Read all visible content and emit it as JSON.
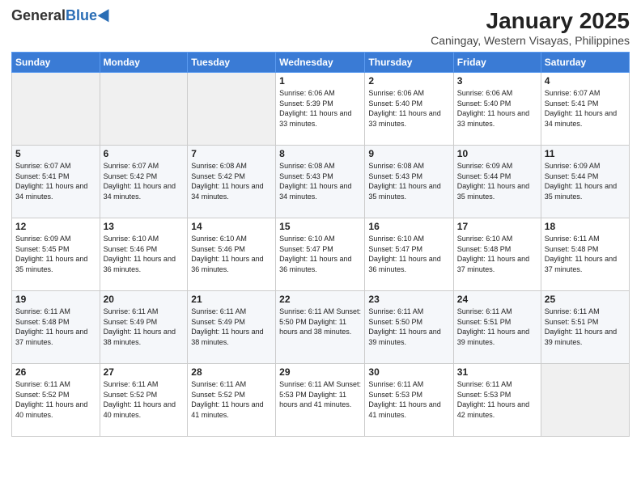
{
  "header": {
    "logo_general": "General",
    "logo_blue": "Blue",
    "title": "January 2025",
    "subtitle": "Caningay, Western Visayas, Philippines"
  },
  "days_of_week": [
    "Sunday",
    "Monday",
    "Tuesday",
    "Wednesday",
    "Thursday",
    "Friday",
    "Saturday"
  ],
  "weeks": [
    [
      {
        "day": "",
        "info": ""
      },
      {
        "day": "",
        "info": ""
      },
      {
        "day": "",
        "info": ""
      },
      {
        "day": "1",
        "info": "Sunrise: 6:06 AM\nSunset: 5:39 PM\nDaylight: 11 hours\nand 33 minutes."
      },
      {
        "day": "2",
        "info": "Sunrise: 6:06 AM\nSunset: 5:40 PM\nDaylight: 11 hours\nand 33 minutes."
      },
      {
        "day": "3",
        "info": "Sunrise: 6:06 AM\nSunset: 5:40 PM\nDaylight: 11 hours\nand 33 minutes."
      },
      {
        "day": "4",
        "info": "Sunrise: 6:07 AM\nSunset: 5:41 PM\nDaylight: 11 hours\nand 34 minutes."
      }
    ],
    [
      {
        "day": "5",
        "info": "Sunrise: 6:07 AM\nSunset: 5:41 PM\nDaylight: 11 hours\nand 34 minutes."
      },
      {
        "day": "6",
        "info": "Sunrise: 6:07 AM\nSunset: 5:42 PM\nDaylight: 11 hours\nand 34 minutes."
      },
      {
        "day": "7",
        "info": "Sunrise: 6:08 AM\nSunset: 5:42 PM\nDaylight: 11 hours\nand 34 minutes."
      },
      {
        "day": "8",
        "info": "Sunrise: 6:08 AM\nSunset: 5:43 PM\nDaylight: 11 hours\nand 34 minutes."
      },
      {
        "day": "9",
        "info": "Sunrise: 6:08 AM\nSunset: 5:43 PM\nDaylight: 11 hours\nand 35 minutes."
      },
      {
        "day": "10",
        "info": "Sunrise: 6:09 AM\nSunset: 5:44 PM\nDaylight: 11 hours\nand 35 minutes."
      },
      {
        "day": "11",
        "info": "Sunrise: 6:09 AM\nSunset: 5:44 PM\nDaylight: 11 hours\nand 35 minutes."
      }
    ],
    [
      {
        "day": "12",
        "info": "Sunrise: 6:09 AM\nSunset: 5:45 PM\nDaylight: 11 hours\nand 35 minutes."
      },
      {
        "day": "13",
        "info": "Sunrise: 6:10 AM\nSunset: 5:46 PM\nDaylight: 11 hours\nand 36 minutes."
      },
      {
        "day": "14",
        "info": "Sunrise: 6:10 AM\nSunset: 5:46 PM\nDaylight: 11 hours\nand 36 minutes."
      },
      {
        "day": "15",
        "info": "Sunrise: 6:10 AM\nSunset: 5:47 PM\nDaylight: 11 hours\nand 36 minutes."
      },
      {
        "day": "16",
        "info": "Sunrise: 6:10 AM\nSunset: 5:47 PM\nDaylight: 11 hours\nand 36 minutes."
      },
      {
        "day": "17",
        "info": "Sunrise: 6:10 AM\nSunset: 5:48 PM\nDaylight: 11 hours\nand 37 minutes."
      },
      {
        "day": "18",
        "info": "Sunrise: 6:11 AM\nSunset: 5:48 PM\nDaylight: 11 hours\nand 37 minutes."
      }
    ],
    [
      {
        "day": "19",
        "info": "Sunrise: 6:11 AM\nSunset: 5:48 PM\nDaylight: 11 hours\nand 37 minutes."
      },
      {
        "day": "20",
        "info": "Sunrise: 6:11 AM\nSunset: 5:49 PM\nDaylight: 11 hours\nand 38 minutes."
      },
      {
        "day": "21",
        "info": "Sunrise: 6:11 AM\nSunset: 5:49 PM\nDaylight: 11 hours\nand 38 minutes."
      },
      {
        "day": "22",
        "info": "Sunrise: 6:11 AM\nSunset: 5:50 PM\nDaylight: 11 hours\nand 38 minutes."
      },
      {
        "day": "23",
        "info": "Sunrise: 6:11 AM\nSunset: 5:50 PM\nDaylight: 11 hours\nand 39 minutes."
      },
      {
        "day": "24",
        "info": "Sunrise: 6:11 AM\nSunset: 5:51 PM\nDaylight: 11 hours\nand 39 minutes."
      },
      {
        "day": "25",
        "info": "Sunrise: 6:11 AM\nSunset: 5:51 PM\nDaylight: 11 hours\nand 39 minutes."
      }
    ],
    [
      {
        "day": "26",
        "info": "Sunrise: 6:11 AM\nSunset: 5:52 PM\nDaylight: 11 hours\nand 40 minutes."
      },
      {
        "day": "27",
        "info": "Sunrise: 6:11 AM\nSunset: 5:52 PM\nDaylight: 11 hours\nand 40 minutes."
      },
      {
        "day": "28",
        "info": "Sunrise: 6:11 AM\nSunset: 5:52 PM\nDaylight: 11 hours\nand 41 minutes."
      },
      {
        "day": "29",
        "info": "Sunrise: 6:11 AM\nSunset: 5:53 PM\nDaylight: 11 hours\nand 41 minutes."
      },
      {
        "day": "30",
        "info": "Sunrise: 6:11 AM\nSunset: 5:53 PM\nDaylight: 11 hours\nand 41 minutes."
      },
      {
        "day": "31",
        "info": "Sunrise: 6:11 AM\nSunset: 5:53 PM\nDaylight: 11 hours\nand 42 minutes."
      },
      {
        "day": "",
        "info": ""
      }
    ]
  ]
}
